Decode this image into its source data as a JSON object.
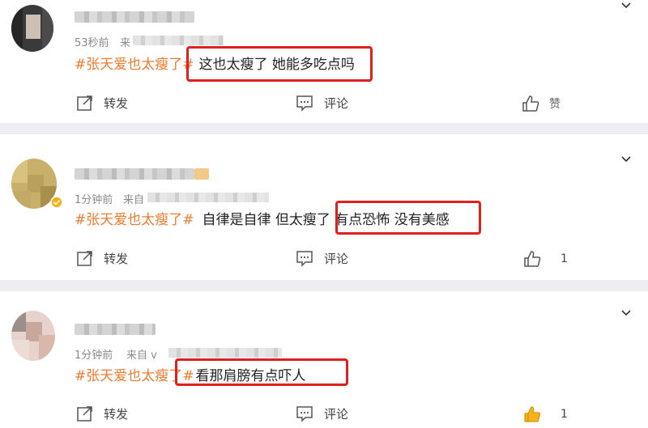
{
  "actions": {
    "repost_label": "转发",
    "comment_label": "评论"
  },
  "comments": [
    {
      "time": "53秒前",
      "source_prefix": "来",
      "hashtag": "#张天爱也太瘦了#",
      "text": "这也太瘦了 她能多吃点吗",
      "like_label": "赞",
      "like_count": ""
    },
    {
      "time": "1分钟前",
      "source_prefix": "来自",
      "hashtag": "#张天爱也太瘦了#",
      "text": "自律是自律 但太瘦了 有点恐怖 没有美感",
      "like_label": "",
      "like_count": "1"
    },
    {
      "time": "1分钟前",
      "source_prefix": "来自 v",
      "hashtag": "#张天爱也太瘦了#",
      "text": "看那肩膀有点吓人",
      "like_label": "",
      "like_count": "1"
    }
  ],
  "colors": {
    "hashtag": "#f07a2e",
    "highlight_box": "#e02020",
    "liked_icon": "#f5b31b",
    "verified_badge": "#f5b31b"
  },
  "icons": [
    "chevron-down-icon",
    "repost-icon",
    "comment-icon",
    "like-icon",
    "verified-badge-icon"
  ]
}
